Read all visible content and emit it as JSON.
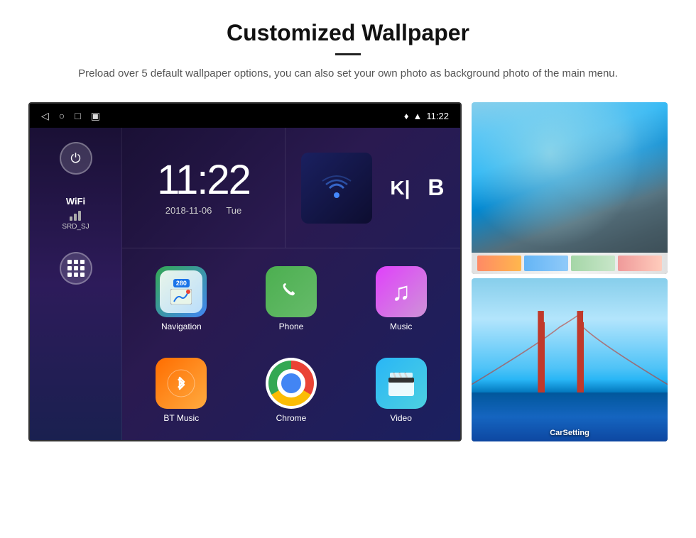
{
  "header": {
    "title": "Customized Wallpaper",
    "subtitle": "Preload over 5 default wallpaper options, you can also set your own photo as background photo of the main menu."
  },
  "statusBar": {
    "time": "11:22",
    "navIcons": [
      "◁",
      "○",
      "□",
      "⬛"
    ],
    "rightIcons": [
      "location",
      "wifi",
      "time"
    ]
  },
  "clock": {
    "time": "11:22",
    "date": "2018-11-06",
    "day": "Tue"
  },
  "wifi": {
    "label": "WiFi",
    "ssid": "SRD_SJ"
  },
  "apps": [
    {
      "id": "navigation",
      "label": "Navigation",
      "badge": "280"
    },
    {
      "id": "phone",
      "label": "Phone"
    },
    {
      "id": "music",
      "label": "Music"
    },
    {
      "id": "bt-music",
      "label": "BT Music"
    },
    {
      "id": "chrome",
      "label": "Chrome"
    },
    {
      "id": "video",
      "label": "Video"
    }
  ],
  "wallpapers": [
    {
      "id": "ice-cave",
      "label": ""
    },
    {
      "id": "bridge",
      "label": "CarSetting"
    }
  ],
  "widgets": [
    {
      "id": "media",
      "letter": ""
    },
    {
      "id": "ki",
      "letter": "K|"
    },
    {
      "id": "b",
      "letter": "B"
    }
  ]
}
